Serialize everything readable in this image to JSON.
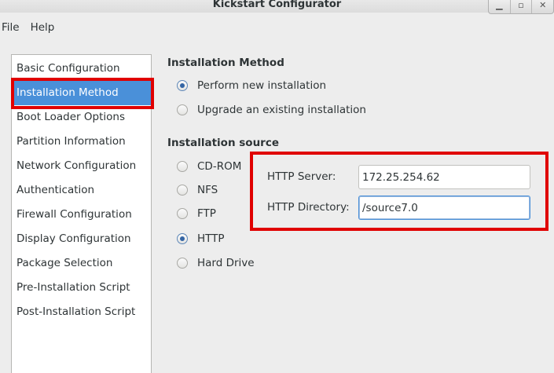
{
  "window": {
    "title": "Kickstart Configurator"
  },
  "menu": {
    "items": [
      "File",
      "Help"
    ]
  },
  "sidebar": {
    "items": [
      "Basic Configuration",
      "Installation Method",
      "Boot Loader Options",
      "Partition Information",
      "Network Configuration",
      "Authentication",
      "Firewall Configuration",
      "Display Configuration",
      "Package Selection",
      "Pre-Installation Script",
      "Post-Installation Script"
    ],
    "selected": "Installation Method"
  },
  "installation_method": {
    "title": "Installation Method",
    "options": [
      {
        "label": "Perform new installation",
        "checked": true
      },
      {
        "label": "Upgrade an existing installation",
        "checked": false
      }
    ]
  },
  "installation_source": {
    "title": "Installation source",
    "options": [
      {
        "label": "CD-ROM",
        "checked": false
      },
      {
        "label": "NFS",
        "checked": false
      },
      {
        "label": "FTP",
        "checked": false
      },
      {
        "label": "HTTP",
        "checked": true
      },
      {
        "label": "Hard Drive",
        "checked": false
      }
    ]
  },
  "http": {
    "server_label": "HTTP Server:",
    "server_value": "172.25.254.62",
    "directory_label": "HTTP Directory:",
    "directory_value": "/source7.0"
  },
  "colors": {
    "selection": "#4a90d9",
    "highlight_box": "#e00000",
    "radio_dot": "#3465a4"
  }
}
